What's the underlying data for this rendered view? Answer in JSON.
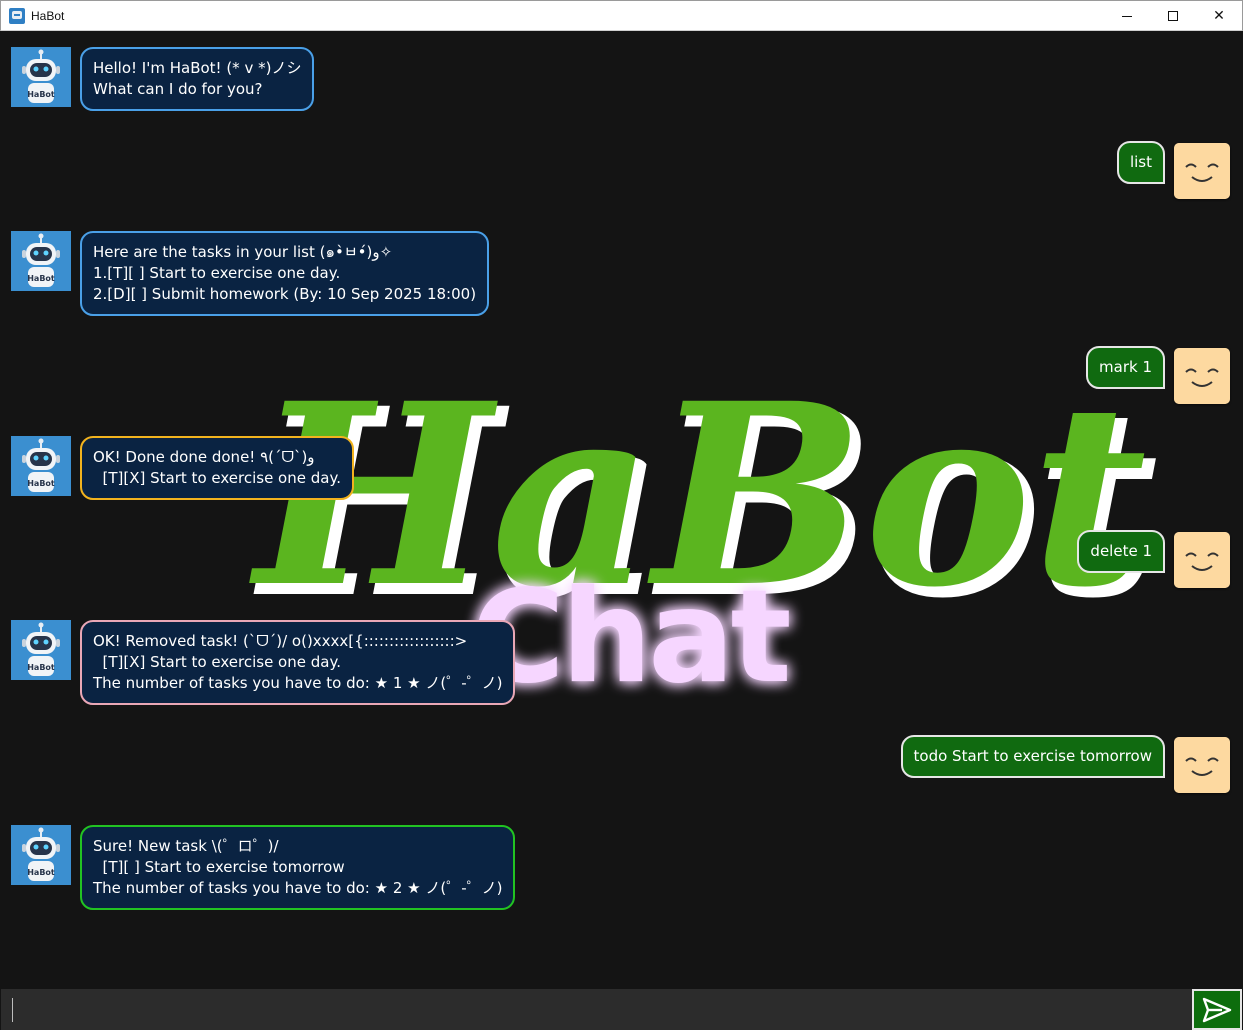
{
  "window": {
    "title": "HaBot",
    "icon": "robot-app-icon",
    "controls": [
      "minimize",
      "maximize",
      "close"
    ],
    "close_glyph": "✕"
  },
  "watermark": {
    "line1": "HaBot",
    "line2": "Chat",
    "line1_color": "#5bb51f",
    "line2_color": "#f6d6ff"
  },
  "colors": {
    "background": "#141414",
    "bot_bubble_bg": "#0a2342",
    "user_bubble_bg": "#106a10",
    "send_button_bg": "#0d6d0d"
  },
  "messages": [
    {
      "sender": "bot",
      "border": "#4aa0e8",
      "text": "Hello! I'm HaBot! (* v *)ノシ\nWhat can I do for you?"
    },
    {
      "sender": "user",
      "text": "list"
    },
    {
      "sender": "bot",
      "border": "#4aa0e8",
      "text": "Here are the tasks in your list (๑•̀ㅂ•́)و✧\n1.[T][ ] Start to exercise one day.\n2.[D][ ] Submit homework (By: 10 Sep 2025 18:00)"
    },
    {
      "sender": "user",
      "text": "mark 1"
    },
    {
      "sender": "bot",
      "border": "#f2b31e",
      "text": "OK! Done done done! ٩(ˊᗜˋ)و\n  [T][X] Start to exercise one day."
    },
    {
      "sender": "user",
      "text": "delete 1"
    },
    {
      "sender": "bot",
      "border": "#e9a7b6",
      "text": "OK! Removed task! (ˋᗜˊ)/ o()xxxx[{::::::::::::::::::>\n  [T][X] Start to exercise one day.\nThe number of tasks you have to do: ★ 1 ★ ノ(゜-゜ノ)"
    },
    {
      "sender": "user",
      "text": "todo Start to exercise tomorrow"
    },
    {
      "sender": "bot",
      "border": "#22c322",
      "text": "Sure! New task \\(゜ロ゜)/\n  [T][ ] Start to exercise tomorrow\nThe number of tasks you have to do: ★ 2 ★ ノ(゜-゜ノ)"
    }
  ],
  "input": {
    "value": "",
    "placeholder": ""
  },
  "send_button": {
    "icon": "send-arrow-icon"
  },
  "avatars": {
    "bot_label": "HaBot",
    "bot_icon": "robot-avatar",
    "user_icon": "smiley-face-avatar"
  }
}
